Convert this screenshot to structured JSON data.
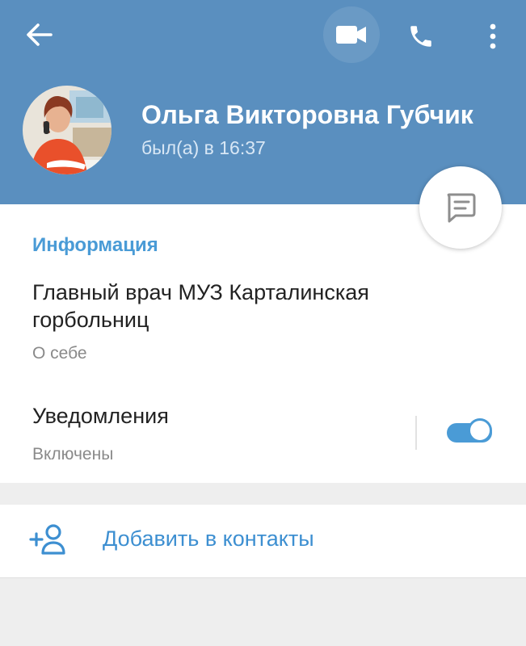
{
  "profile": {
    "name": "Ольга Викторовна Губчик",
    "status": "был(а) в 16:37"
  },
  "info": {
    "section_title": "Информация",
    "bio": "Главный врач МУЗ Карталинская горбольниц",
    "bio_caption": "О себе"
  },
  "notifications": {
    "title": "Уведомления",
    "status": "Включены",
    "enabled": true
  },
  "actions": {
    "add_contact": "Добавить в контакты"
  },
  "icons": {
    "back": "arrow-left-icon",
    "video": "video-camera-icon",
    "phone": "phone-icon",
    "more": "more-vertical-icon",
    "message": "message-bubble-icon",
    "add_contact": "add-person-icon"
  },
  "colors": {
    "header": "#5a8fbf",
    "accent": "#4a9bd6",
    "link": "#3d8fd1"
  }
}
